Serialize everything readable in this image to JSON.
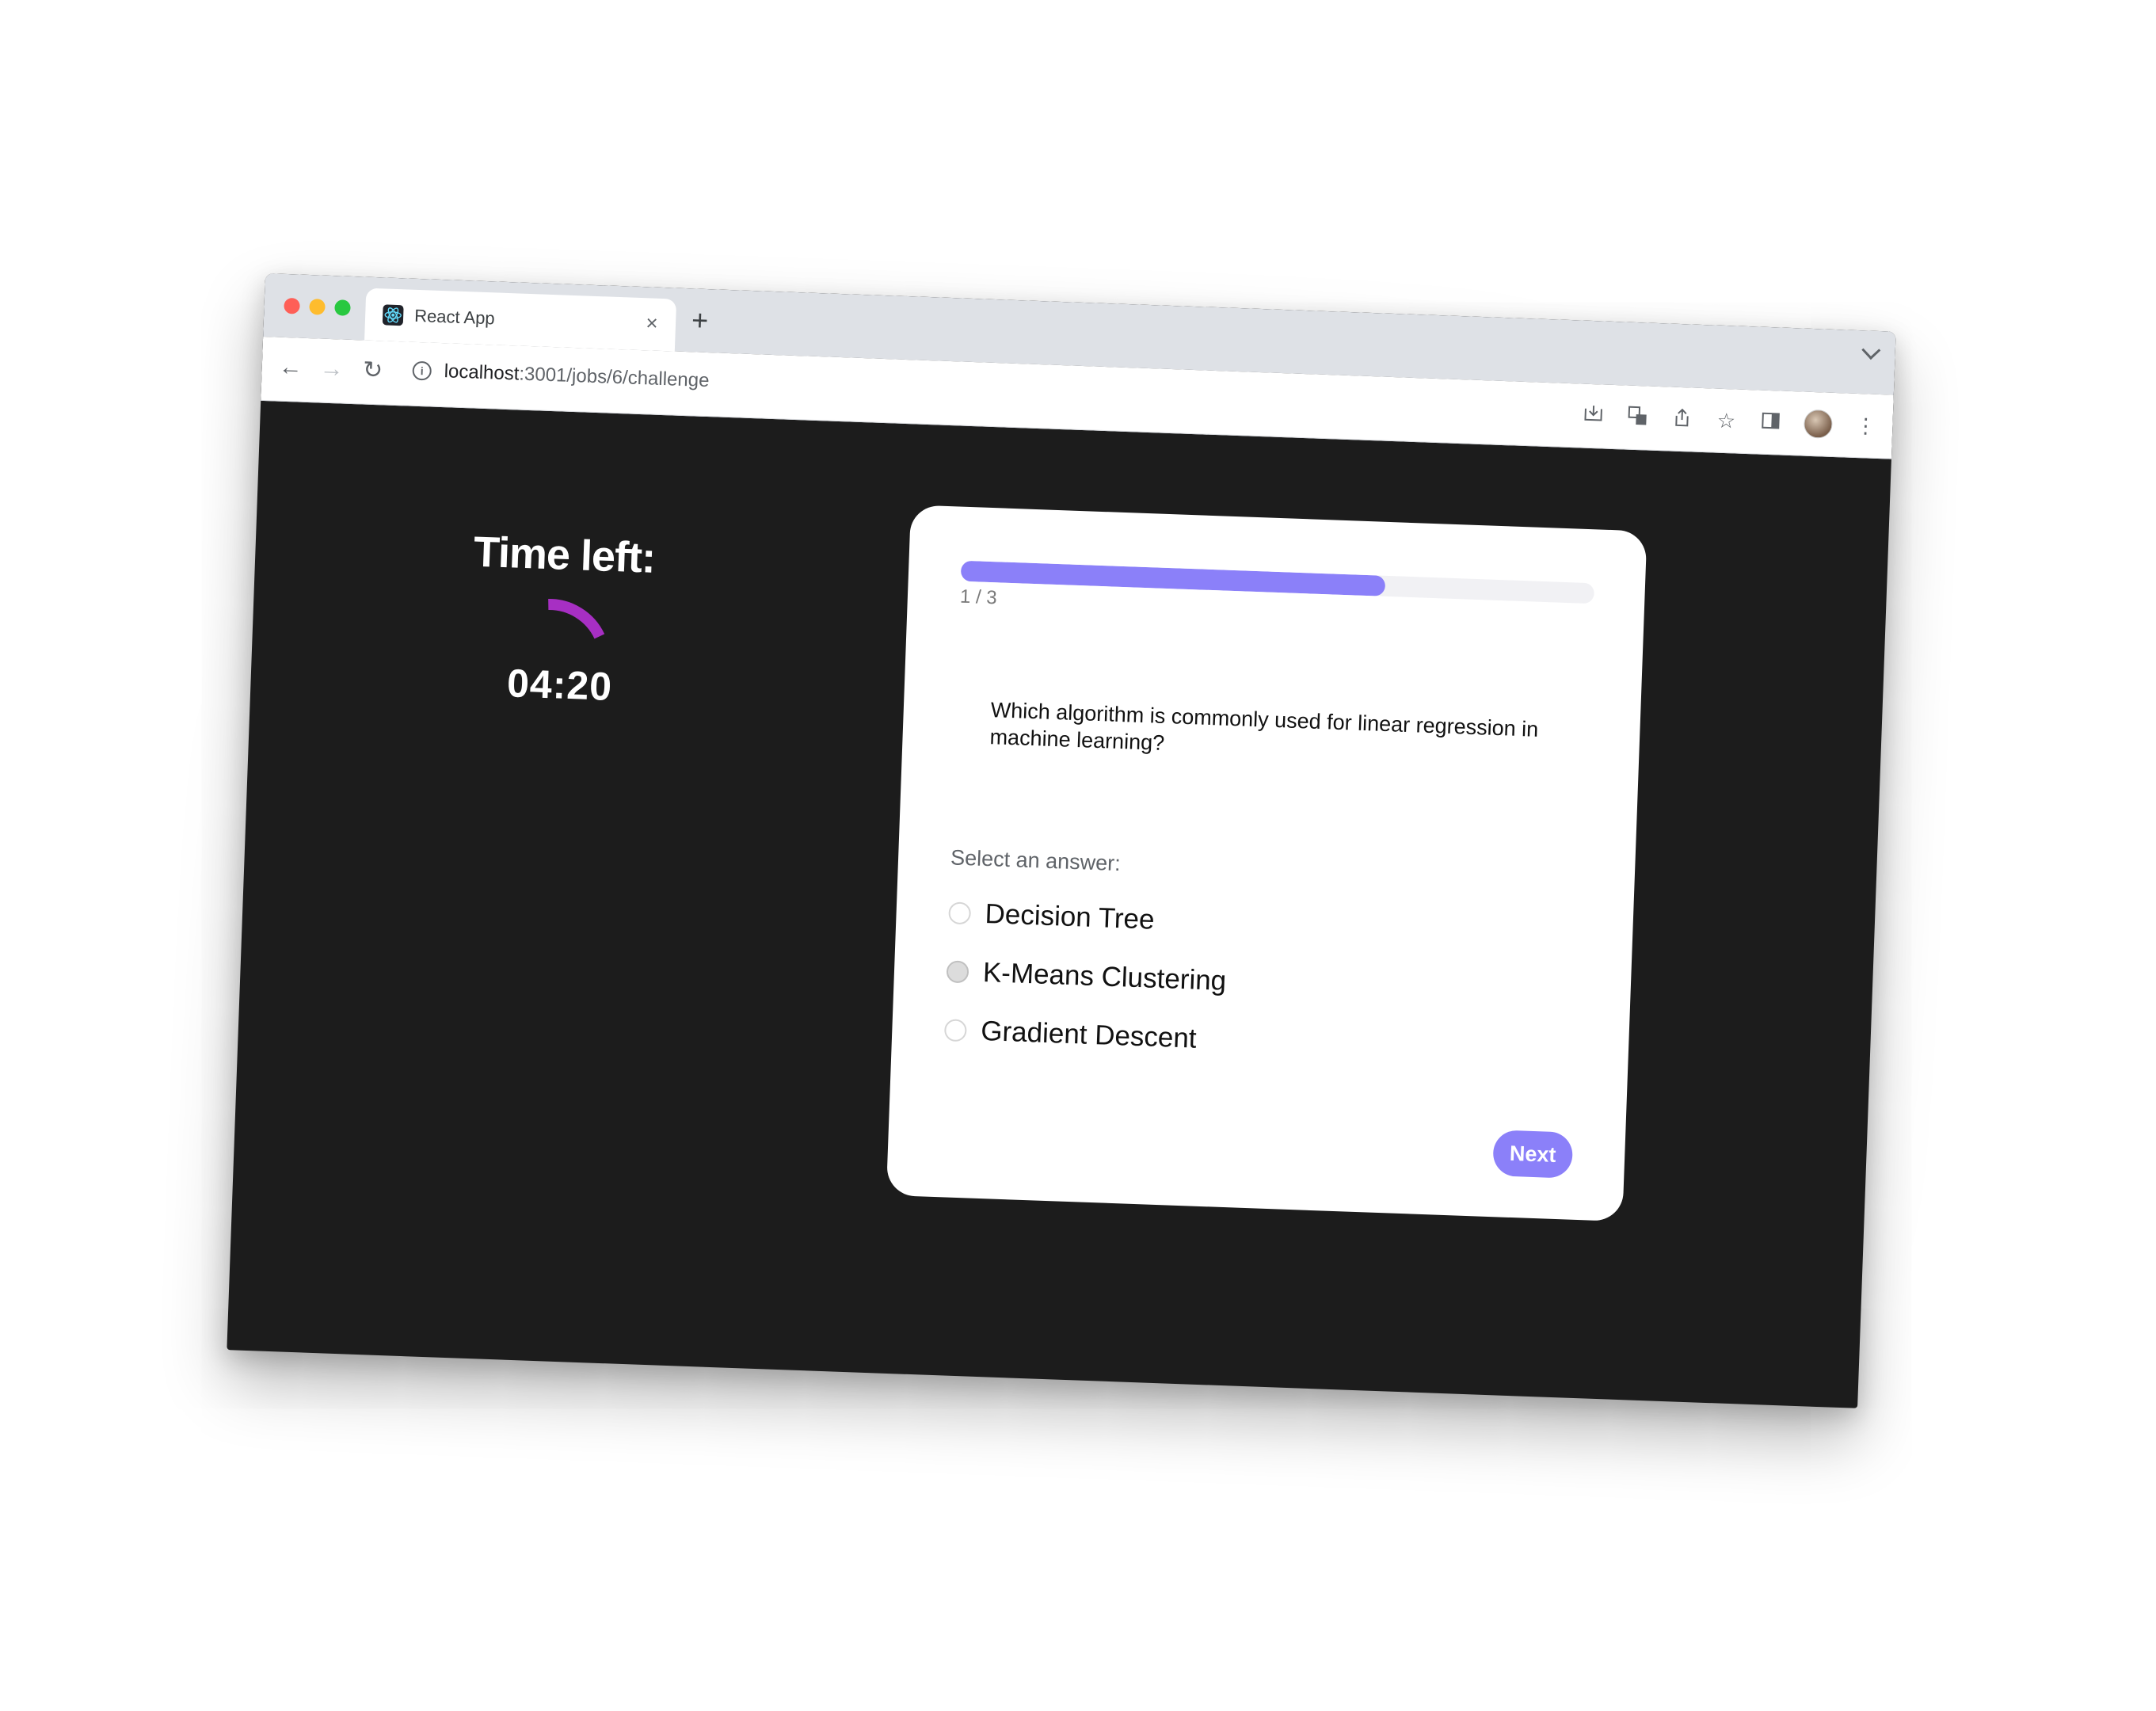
{
  "browser": {
    "tab_title": "React App",
    "tab_close": "×",
    "new_tab": "+",
    "url_host": "localhost",
    "url_path": ":3001/jobs/6/challenge",
    "nav": {
      "back": "←",
      "forward": "→",
      "reload": "↻"
    },
    "toolbar_icons": [
      "install-icon",
      "translate-icon",
      "share-icon",
      "bookmark-star-icon",
      "side-panel-icon",
      "profile-avatar",
      "more-menu-icon"
    ]
  },
  "timer": {
    "title": "Time left:",
    "value": "04:20",
    "arc_color": "#a72fc3"
  },
  "quiz": {
    "progress_label": "1 / 3",
    "progress_fraction": 0.67,
    "progress_color": "#8b80f9",
    "question": "Which algorithm is commonly used for linear regression in machine learning?",
    "select_label": "Select an answer:",
    "options": [
      {
        "label": "Decision Tree"
      },
      {
        "label": "K-Means Clustering"
      },
      {
        "label": "Gradient Descent"
      }
    ],
    "next_label": "Next"
  }
}
